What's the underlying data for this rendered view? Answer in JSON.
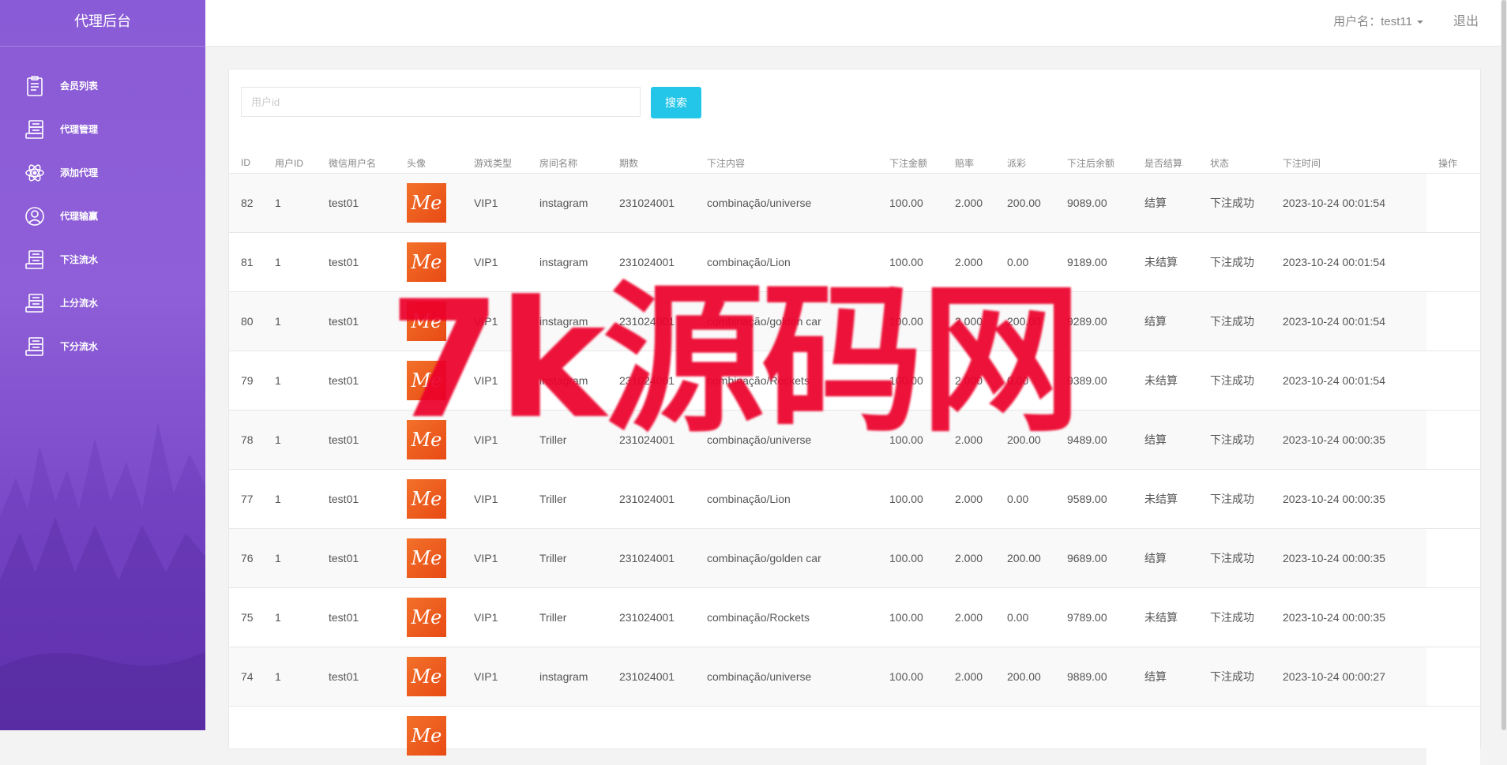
{
  "app": {
    "title": "代理后台"
  },
  "sidebar": {
    "items": [
      {
        "label": "会员列表",
        "icon": "clipboard-icon"
      },
      {
        "label": "代理管理",
        "icon": "server-icon"
      },
      {
        "label": "添加代理",
        "icon": "atom-icon"
      },
      {
        "label": "代理输赢",
        "icon": "user-circle-icon"
      },
      {
        "label": "下注流水",
        "icon": "server-icon"
      },
      {
        "label": "上分流水",
        "icon": "server-icon"
      },
      {
        "label": "下分流水",
        "icon": "server-icon"
      }
    ]
  },
  "header": {
    "user_label": "用户名：test11",
    "logout_label": "退出"
  },
  "search": {
    "placeholder": "用户id",
    "value": "",
    "button_label": "搜索"
  },
  "table": {
    "columns": [
      "ID",
      "用户ID",
      "微信用户名",
      "头像",
      "游戏类型",
      "房间名称",
      "期数",
      "下注内容",
      "下注金额",
      "赔率",
      "派彩",
      "下注后余额",
      "是否结算",
      "状态",
      "下注时间",
      "操作"
    ],
    "rows": [
      {
        "id": "82",
        "user_id": "1",
        "wechat_name": "test01",
        "game_type": "VIP1",
        "room": "instagram",
        "period": "231024001",
        "content": "combinação/universe",
        "amount": "100.00",
        "odds": "2.000",
        "payout": "200.00",
        "balance": "9089.00",
        "settled": "结算",
        "status": "下注成功",
        "time": "2023-10-24 00:01:54"
      },
      {
        "id": "81",
        "user_id": "1",
        "wechat_name": "test01",
        "game_type": "VIP1",
        "room": "instagram",
        "period": "231024001",
        "content": "combinação/Lion",
        "amount": "100.00",
        "odds": "2.000",
        "payout": "0.00",
        "balance": "9189.00",
        "settled": "未结算",
        "status": "下注成功",
        "time": "2023-10-24 00:01:54"
      },
      {
        "id": "80",
        "user_id": "1",
        "wechat_name": "test01",
        "game_type": "VIP1",
        "room": "instagram",
        "period": "231024001",
        "content": "combinação/golden car",
        "amount": "100.00",
        "odds": "2.000",
        "payout": "200.00",
        "balance": "9289.00",
        "settled": "结算",
        "status": "下注成功",
        "time": "2023-10-24 00:01:54"
      },
      {
        "id": "79",
        "user_id": "1",
        "wechat_name": "test01",
        "game_type": "VIP1",
        "room": "instagram",
        "period": "231024001",
        "content": "combinação/Rockets",
        "amount": "100.00",
        "odds": "2.000",
        "payout": "0.00",
        "balance": "9389.00",
        "settled": "未结算",
        "status": "下注成功",
        "time": "2023-10-24 00:01:54"
      },
      {
        "id": "78",
        "user_id": "1",
        "wechat_name": "test01",
        "game_type": "VIP1",
        "room": "Triller",
        "period": "231024001",
        "content": "combinação/universe",
        "amount": "100.00",
        "odds": "2.000",
        "payout": "200.00",
        "balance": "9489.00",
        "settled": "结算",
        "status": "下注成功",
        "time": "2023-10-24 00:00:35"
      },
      {
        "id": "77",
        "user_id": "1",
        "wechat_name": "test01",
        "game_type": "VIP1",
        "room": "Triller",
        "period": "231024001",
        "content": "combinação/Lion",
        "amount": "100.00",
        "odds": "2.000",
        "payout": "0.00",
        "balance": "9589.00",
        "settled": "未结算",
        "status": "下注成功",
        "time": "2023-10-24 00:00:35"
      },
      {
        "id": "76",
        "user_id": "1",
        "wechat_name": "test01",
        "game_type": "VIP1",
        "room": "Triller",
        "period": "231024001",
        "content": "combinação/golden car",
        "amount": "100.00",
        "odds": "2.000",
        "payout": "200.00",
        "balance": "9689.00",
        "settled": "结算",
        "status": "下注成功",
        "time": "2023-10-24 00:00:35"
      },
      {
        "id": "75",
        "user_id": "1",
        "wechat_name": "test01",
        "game_type": "VIP1",
        "room": "Triller",
        "period": "231024001",
        "content": "combinação/Rockets",
        "amount": "100.00",
        "odds": "2.000",
        "payout": "0.00",
        "balance": "9789.00",
        "settled": "未结算",
        "status": "下注成功",
        "time": "2023-10-24 00:00:35"
      },
      {
        "id": "74",
        "user_id": "1",
        "wechat_name": "test01",
        "game_type": "VIP1",
        "room": "instagram",
        "period": "231024001",
        "content": "combinação/universe",
        "amount": "100.00",
        "odds": "2.000",
        "payout": "200.00",
        "balance": "9889.00",
        "settled": "结算",
        "status": "下注成功",
        "time": "2023-10-24 00:00:27"
      }
    ],
    "avatar_text": "Me"
  },
  "watermark": {
    "text": "7k源码网",
    "color": "#ec002a"
  },
  "colors": {
    "accent": "#23c6e8",
    "sidebar": "#8a5bd6"
  }
}
